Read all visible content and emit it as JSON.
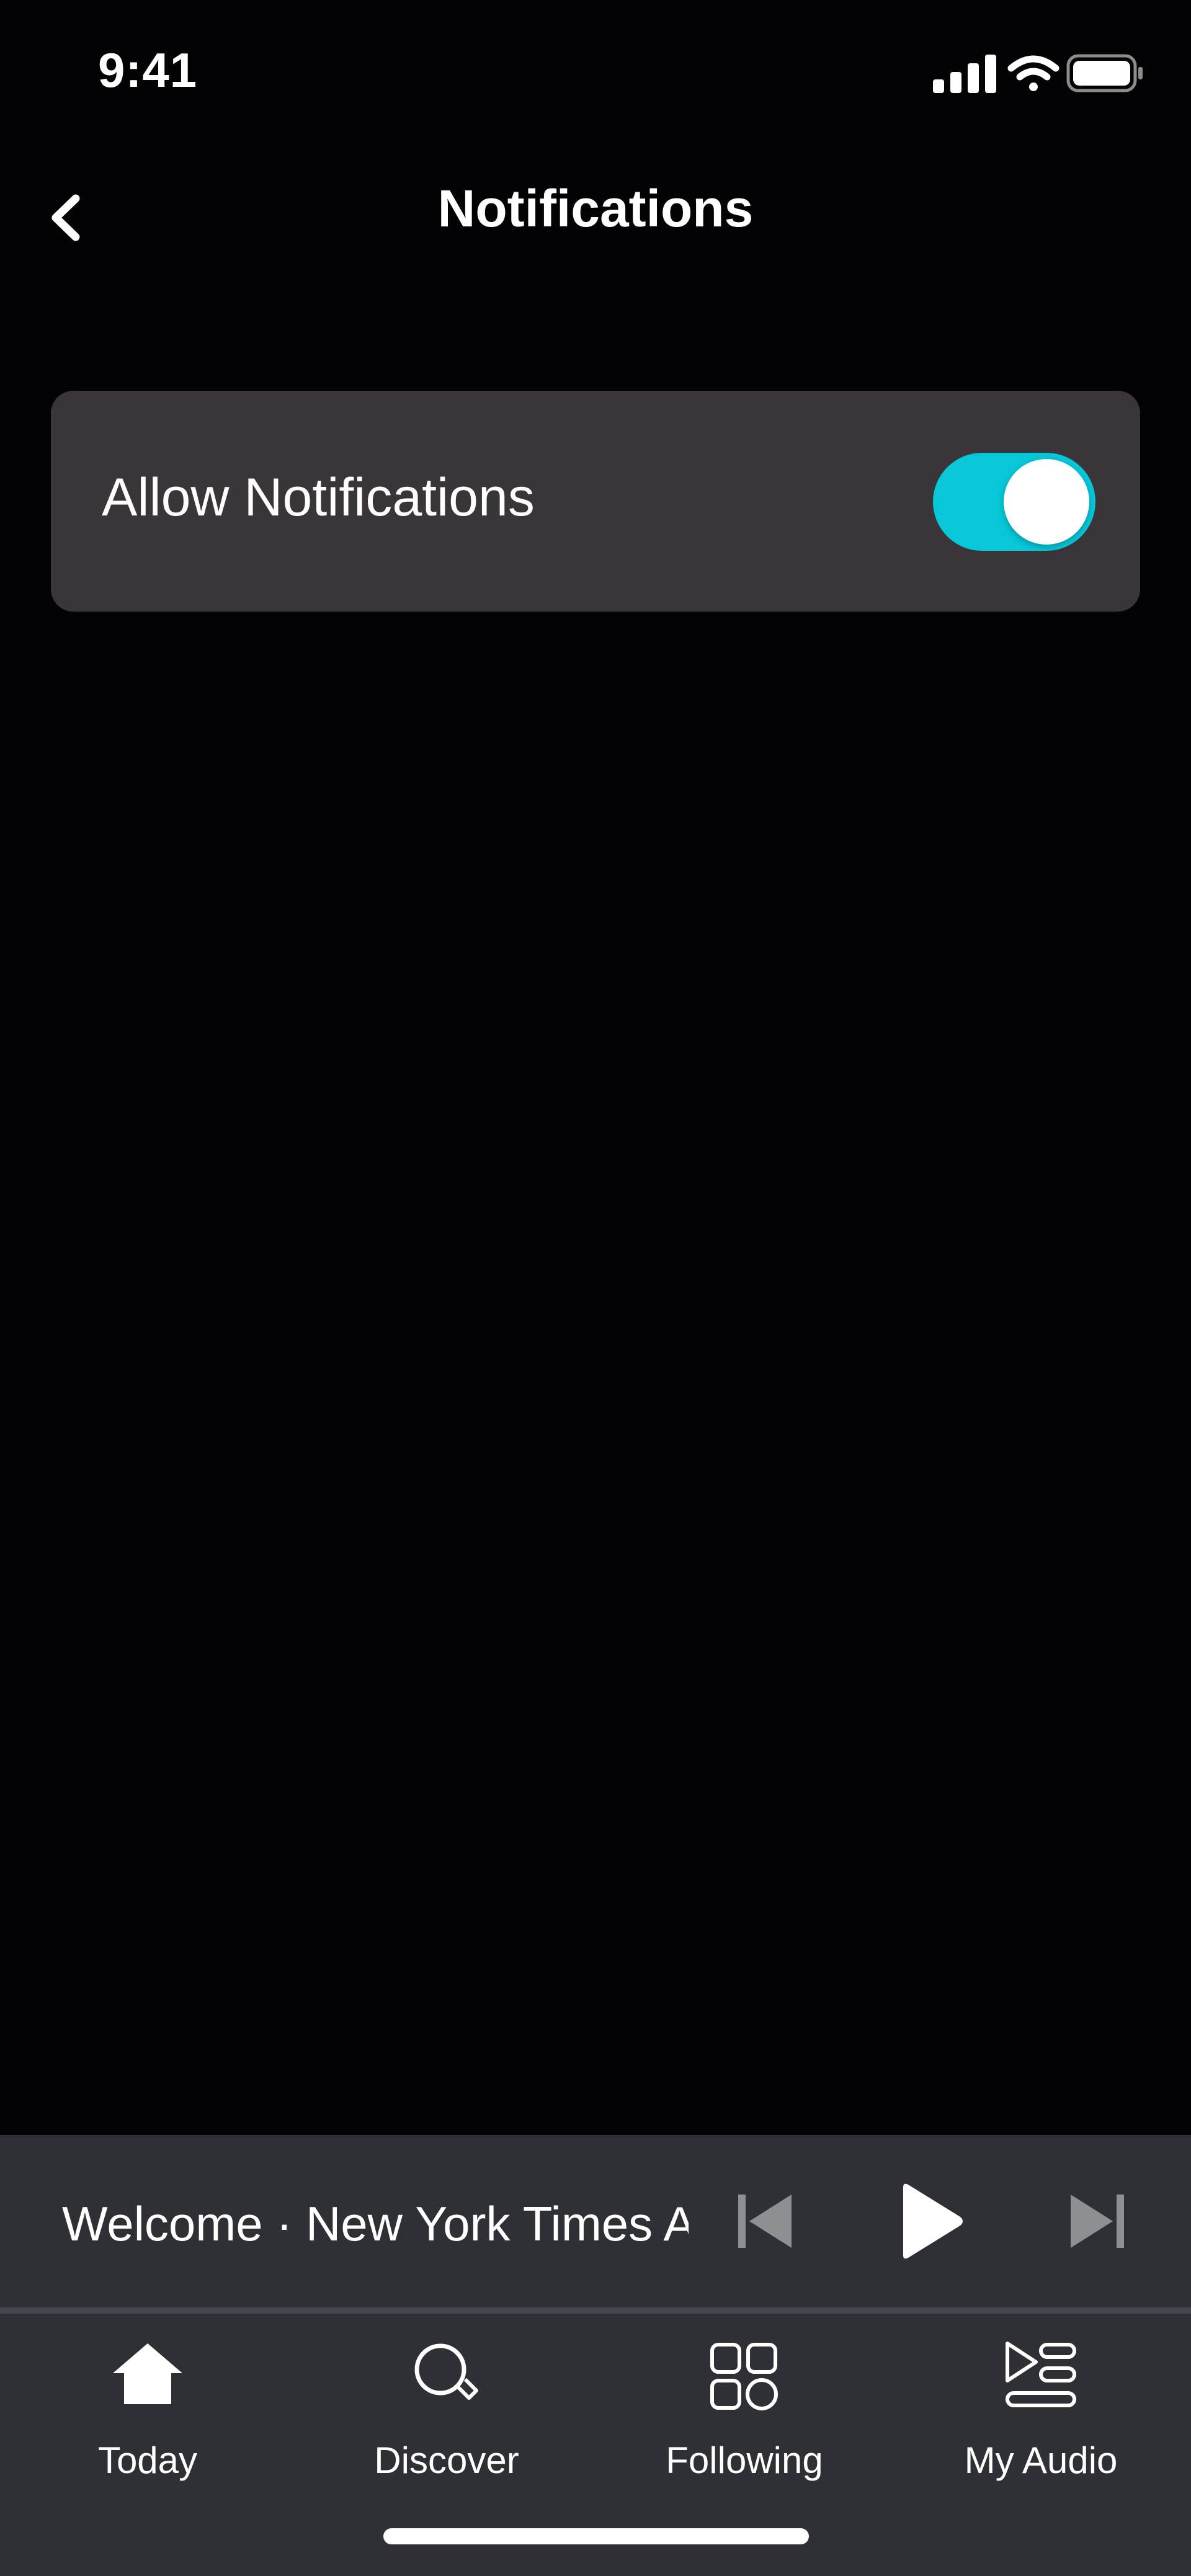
{
  "status_bar": {
    "time": "9:41",
    "icons": [
      "cellular-signal-icon",
      "wifi-icon",
      "battery-icon"
    ]
  },
  "nav": {
    "title": "Notifications",
    "back_icon": "chevron-left-icon"
  },
  "settings": {
    "allow_notifications": {
      "label": "Allow Notifications",
      "enabled": true
    }
  },
  "mini_player": {
    "title": "Welcome · New York Times Audio",
    "controls": [
      "skip-back-icon",
      "play-icon",
      "skip-forward-icon"
    ]
  },
  "tab_bar": {
    "tabs": [
      {
        "label": "Today",
        "icon": "home-icon",
        "active": true
      },
      {
        "label": "Discover",
        "icon": "search-icon",
        "active": false
      },
      {
        "label": "Following",
        "icon": "grid-icon",
        "active": false
      },
      {
        "label": "My Audio",
        "icon": "playlist-icon",
        "active": false
      }
    ]
  },
  "colors": {
    "background": "#030204",
    "card": "#393538",
    "toggle_on": "#07c7d8",
    "player_bg": "#2e3035"
  }
}
